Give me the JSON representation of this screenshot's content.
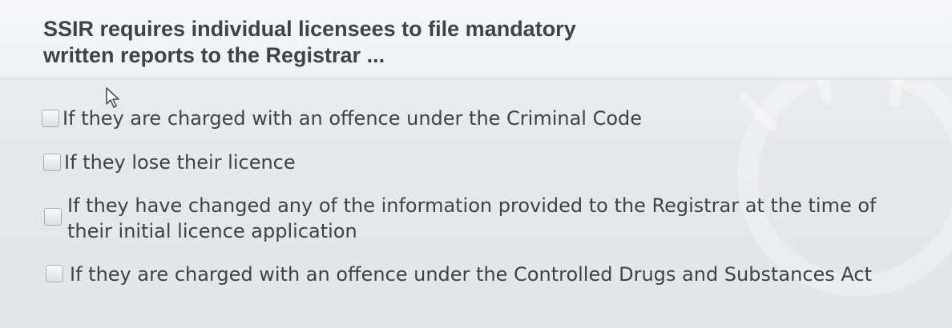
{
  "question": {
    "title": "SSIR requires individual licensees to file mandatory written reports to the Registrar ..."
  },
  "answers": [
    {
      "label": "If they are charged with an offence under the Criminal Code",
      "checked": false
    },
    {
      "label": "If they lose their licence",
      "checked": false
    },
    {
      "label_line1": "If they have changed any of the information provided to the Registrar at the time of",
      "label_line2": "their initial licence application",
      "checked": false
    },
    {
      "label": "If they are charged with an offence under the Controlled Drugs and Substances Act",
      "checked": false
    }
  ],
  "icons": {
    "cursor": "arrow-cursor-icon"
  }
}
